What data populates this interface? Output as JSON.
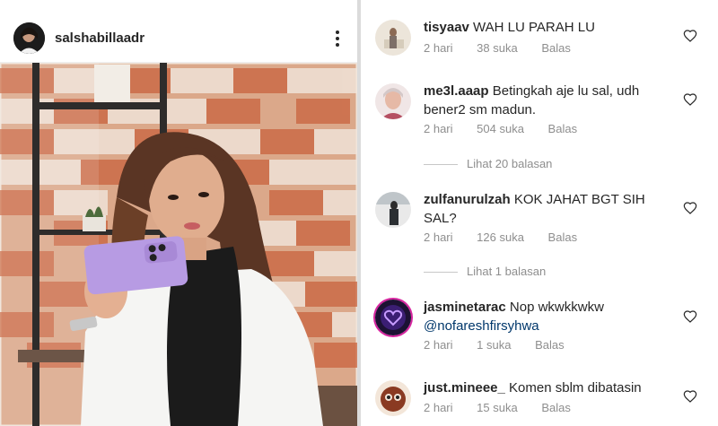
{
  "post": {
    "username": "salshabillaadr",
    "avatar_icon": "profile-photo",
    "more_icon": "more-options-icon"
  },
  "comments": [
    {
      "username": "tisyaav",
      "text": "WAH LU PARAH LU",
      "time": "2 hari",
      "likes": "38 suka",
      "reply": "Balas"
    },
    {
      "username": "me3l.aaap",
      "text": "Betingkah aje lu sal, udh bener2 sm madun.",
      "time": "2 hari",
      "likes": "504 suka",
      "reply": "Balas",
      "view_replies": "Lihat 20 balasan"
    },
    {
      "username": "zulfanurulzah",
      "text": "KOK JAHAT BGT SIH SAL?",
      "time": "2 hari",
      "likes": "126 suka",
      "reply": "Balas",
      "view_replies": "Lihat 1 balasan"
    },
    {
      "username": "jasminetarac",
      "text": "Nop wkwkkwkw",
      "mention": "@nofareshfirsyhwa",
      "time": "2 hari",
      "likes": "1 suka",
      "reply": "Balas"
    },
    {
      "username": "just.mineee_",
      "text": "Komen sblm dibatasin",
      "time": "2 hari",
      "likes": "15 suka",
      "reply": "Balas"
    }
  ],
  "colors": {
    "text": "#262626",
    "meta": "#8e8e8e",
    "mention": "#00376b",
    "divider": "#dbdbdb",
    "phone": "#b79be3"
  }
}
